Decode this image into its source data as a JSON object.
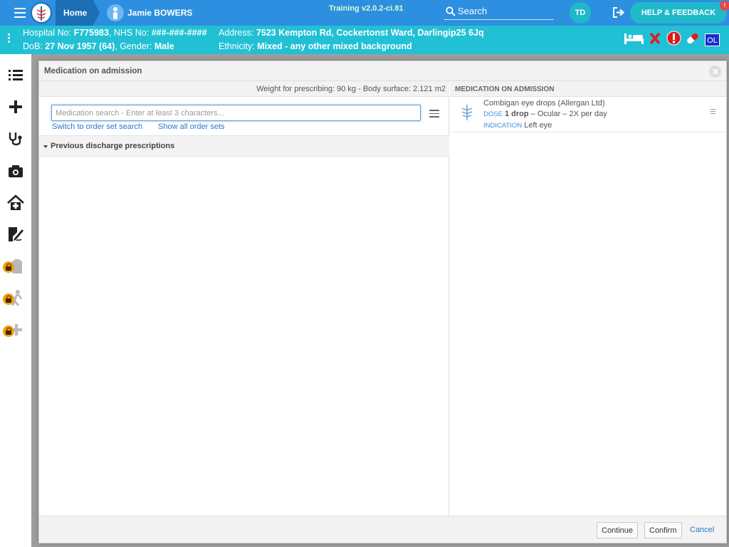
{
  "topbar": {
    "home_label": "Home",
    "patient_name": "Jamie BOWERS",
    "version": "Training v2.0.2-ci.81",
    "search_label": "Search",
    "user_initials": "TD",
    "help_label": "HELP & FEEDBACK",
    "help_badge": "!"
  },
  "banner": {
    "hospital_no_label": "Hospital No:",
    "hospital_no": "F775983",
    "nhs_no_label": ", NHS No:",
    "nhs_no": "###-###-####",
    "dob_label": "DoB:",
    "dob": "27 Nov 1957 (64)",
    "gender_label": ", Gender:",
    "gender": "Male",
    "address_label": "Address:",
    "address": "7523 Kempton Rd, Cockertonst Ward, Darlingip25 6Jq",
    "ethnicity_label": "Ethnicity:",
    "ethnicity": "Mixed - any other mixed background",
    "ol_badge": "OL",
    "alert_colors": {
      "red": "#e01b1b",
      "white": "#ffffff"
    }
  },
  "sidebar": {
    "icons": [
      "list-icon",
      "add-icon",
      "stethoscope-icon",
      "camera-icon",
      "home-medical-icon",
      "signature-icon",
      "clipboard-locked-icon",
      "walking-locked-icon",
      "plus-locked-icon"
    ]
  },
  "modal": {
    "title": "Medication on admission",
    "weight_info": "Weight for prescribing: 90 kg - Body surface: 2.121 m2",
    "search_placeholder": "Medication search - Enter at least 3 characters...",
    "switch_link": "Switch to order set search",
    "show_link": "Show all order sets",
    "prev_section": "Previous discharge prescriptions",
    "moa_header": "MEDICATION ON ADMISSION",
    "medication": {
      "name": "Combigan eye drops (Allergan Ltd)",
      "dose_tag": "DOSE",
      "dose_value": "1 drop",
      "dose_rest": " – Ocular – 2X per day",
      "indication_tag": "INDICATION",
      "indication": "Left eye"
    },
    "footer": {
      "continue": "Continue",
      "confirm": "Confirm",
      "cancel": "Cancel"
    }
  }
}
